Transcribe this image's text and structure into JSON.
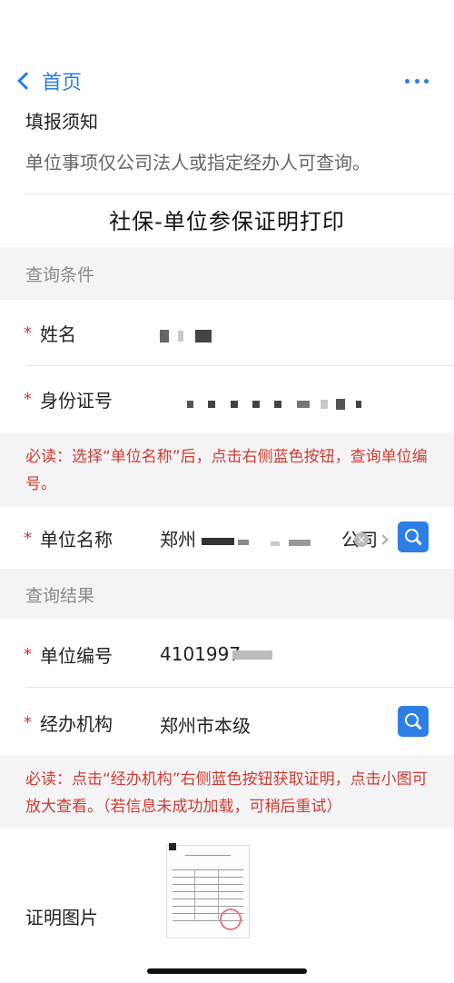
{
  "nav": {
    "back_label": "首页"
  },
  "notice": {
    "title": "填报须知",
    "text": "单位事项仅公司法人或指定经办人可查询。"
  },
  "page_title": "社保-单位参保证明打印",
  "query_section": {
    "header": "查询条件",
    "name_label": "姓名",
    "id_label": "身份证号",
    "warning": "必读：选择“单位名称”后，点击右侧蓝色按钮，查询单位编号。",
    "unit_name_label": "单位名称",
    "unit_name_prefix": "郑州",
    "unit_name_suffix": "公司"
  },
  "result_section": {
    "header": "查询结果",
    "unit_code_label": "单位编号",
    "unit_code_value": "4101997",
    "agency_label": "经办机构",
    "agency_value": "郑州市本级",
    "warning": "必读：点击“经办机构”右侧蓝色按钮获取证明，点击小图可放大查看。（若信息未成功加载，可稍后重试）",
    "cert_label": "证明图片"
  },
  "required_mark": "*",
  "colors": {
    "accent_blue": "#2d7fe3",
    "required_red": "#d9352a",
    "section_bg": "#f4f4f6"
  }
}
